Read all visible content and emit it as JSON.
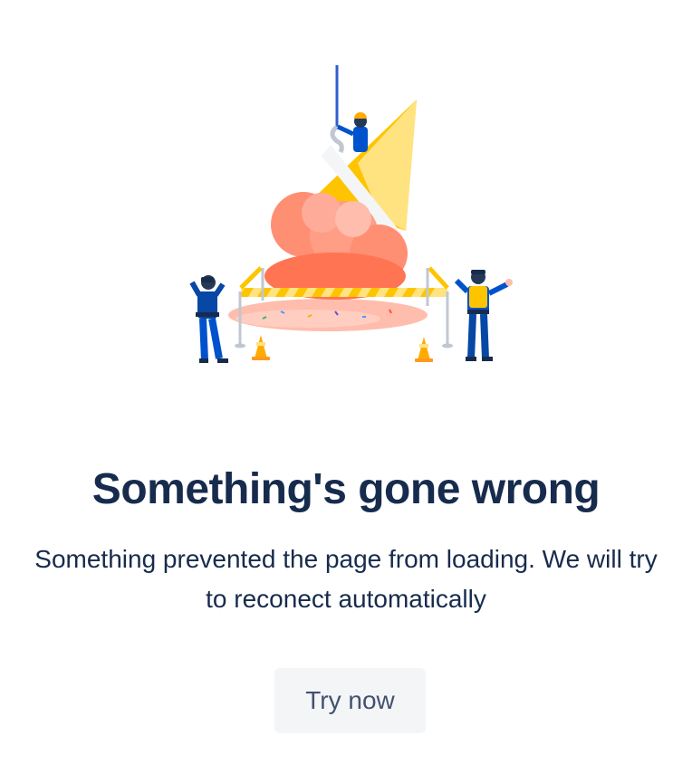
{
  "error": {
    "title": "Something's gone wrong",
    "message": "Something prevented the page from loading. We will try to reconect automatically",
    "button_label": "Try now"
  },
  "illustration": {
    "icon": "dropped-ice-cream-illustration"
  },
  "colors": {
    "heading": "#172b4d",
    "button_bg": "#f4f5f7",
    "button_text": "#42526e",
    "cone": "#ffc83a",
    "ice_cream": "#ff8f73",
    "worker_blue": "#0052cc"
  }
}
